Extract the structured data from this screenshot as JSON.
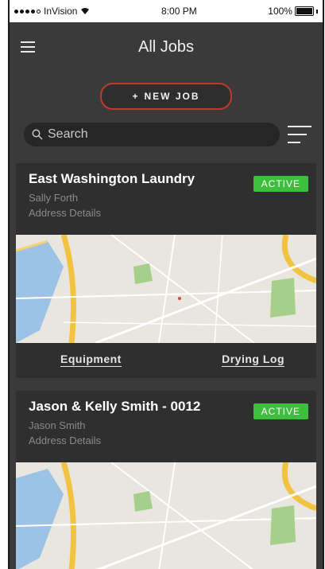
{
  "status": {
    "carrier": "InVision",
    "time": "8:00 PM",
    "battery": "100%"
  },
  "header": {
    "title": "All Jobs"
  },
  "new_job": {
    "label": "NEW JOB",
    "plus": "+"
  },
  "search": {
    "placeholder": "Search"
  },
  "jobs": [
    {
      "title": "East Washington Laundry",
      "contact": "Sally Forth",
      "address": "Address Details",
      "status": "ACTIVE",
      "actions": [
        "Equipment",
        "Drying Log"
      ]
    },
    {
      "title": "Jason & Kelly Smith - 0012",
      "contact": "Jason Smith",
      "address": "Address Details",
      "status": "ACTIVE"
    }
  ],
  "colors": {
    "accent": "#c0392b",
    "active": "#3dbf3d",
    "background": "#3a3a3a"
  },
  "icons": [
    "menu-icon",
    "plus-icon",
    "search-icon",
    "filter-icon",
    "wifi-icon",
    "battery-icon"
  ]
}
